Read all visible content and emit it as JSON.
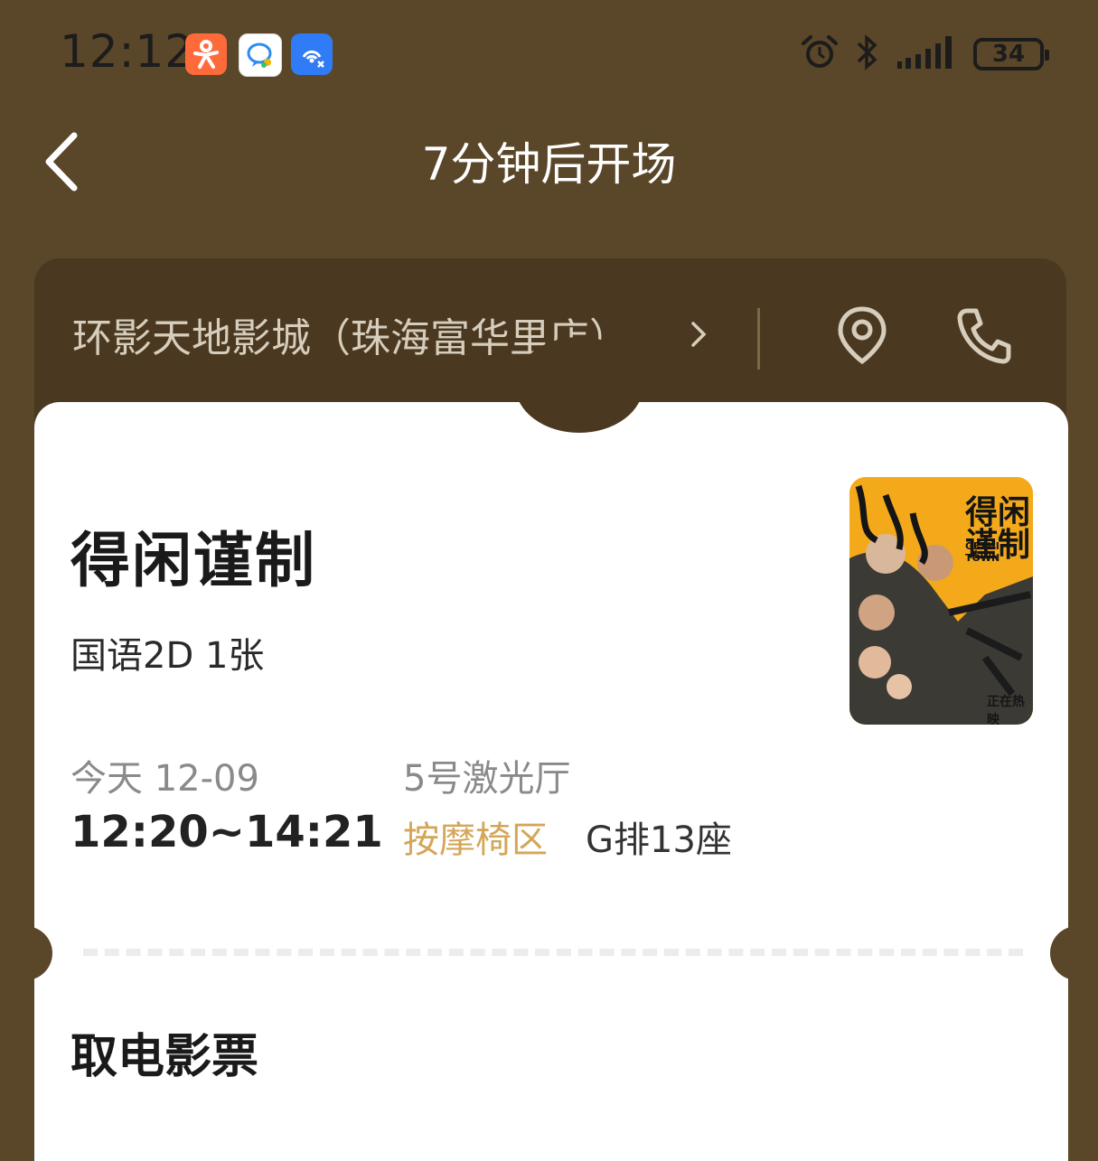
{
  "status": {
    "time": "12:12",
    "battery": "34",
    "icons": [
      "dianping-app-icon",
      "messenger-app-icon",
      "hotspot-app-icon",
      "alarm-icon",
      "bluetooth-icon",
      "signal-icon",
      "battery-icon"
    ]
  },
  "nav": {
    "title": "7分钟后开场"
  },
  "cinema": {
    "name": "环影天地影城（珠海富华里店）",
    "arrow": "›"
  },
  "ticket": {
    "title": "得闲谨制",
    "format": "国语2D 1张",
    "date": "今天 12-09",
    "showtime": "12:20~14:21",
    "hall": "5号激光厅",
    "seat_zone": "按摩椅区",
    "seat": "G排13座"
  },
  "poster": {
    "title_cn": "得闲谨制",
    "title_en": "GEZHI TOWN",
    "tag": "正在热映",
    "accent": "#f3a91a"
  },
  "pickup": {
    "title": "取电影票"
  },
  "colors": {
    "background": "#5a4628",
    "card": "#4a3920",
    "seat_zone": "#d4a657"
  }
}
